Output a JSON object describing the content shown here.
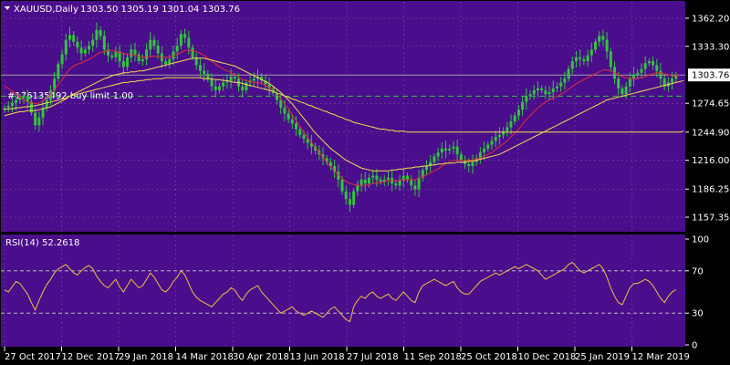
{
  "header": {
    "symbol": "XAUUSD,Daily",
    "ohlc": "1303.50 1305.19 1301.04 1303.76"
  },
  "colors": {
    "background": "#4a0d8c",
    "frame": "#000000",
    "candle": "#2fc73a",
    "ma_fast": "#e03030",
    "ma_slow": "#f4e04a",
    "rsi_line": "#f0c040",
    "grid": "#9ea0a6",
    "price_tag_bg": "#ffffff",
    "text": "#ffffff"
  },
  "order_label": "#176135492 buy limit 1.00",
  "rsi_label": "RSI(14) 52.2618",
  "chart_data": [
    {
      "type": "candlestick",
      "title": "XAUUSD,Daily",
      "x": [
        "27 Oct 2017",
        "12 Dec 2017",
        "29 Jan 2018",
        "14 Mar 2018",
        "30 Apr 2018",
        "13 Jun 2018",
        "27 Jul 2018",
        "11 Sep 2018",
        "25 Oct 2018",
        "10 Dec 2018",
        "25 Jan 2019",
        "12 Mar 2019"
      ],
      "price_axis_ticks": [
        "1362.20",
        "1333.30",
        "1303.76",
        "1274.65",
        "1244.90",
        "1216.00",
        "1186.25",
        "1157.35"
      ],
      "ylim": [
        1157.35,
        1362.2
      ],
      "current_price": 1303.76,
      "order_level": 1282,
      "close_series": [
        1270,
        1272,
        1275,
        1278,
        1280,
        1282,
        1276,
        1265,
        1252,
        1260,
        1270,
        1278,
        1288,
        1300,
        1315,
        1325,
        1340,
        1345,
        1338,
        1332,
        1326,
        1330,
        1334,
        1340,
        1350,
        1344,
        1330,
        1324,
        1322,
        1328,
        1318,
        1312,
        1322,
        1330,
        1325,
        1318,
        1320,
        1330,
        1340,
        1334,
        1326,
        1318,
        1315,
        1320,
        1328,
        1334,
        1346,
        1342,
        1332,
        1322,
        1314,
        1308,
        1305,
        1300,
        1292,
        1288,
        1292,
        1296,
        1298,
        1302,
        1300,
        1292,
        1288,
        1296,
        1298,
        1300,
        1302,
        1298,
        1294,
        1290,
        1285,
        1278,
        1270,
        1264,
        1258,
        1254,
        1248,
        1242,
        1238,
        1234,
        1230,
        1226,
        1222,
        1218,
        1214,
        1210,
        1204,
        1196,
        1184,
        1176,
        1170,
        1184,
        1190,
        1196,
        1192,
        1198,
        1200,
        1196,
        1194,
        1196,
        1198,
        1192,
        1190,
        1195,
        1200,
        1196,
        1190,
        1186,
        1198,
        1206,
        1210,
        1214,
        1220,
        1224,
        1228,
        1226,
        1228,
        1230,
        1222,
        1216,
        1212,
        1210,
        1214,
        1218,
        1224,
        1228,
        1232,
        1236,
        1240,
        1242,
        1246,
        1250,
        1256,
        1262,
        1268,
        1276,
        1282,
        1284,
        1288,
        1290,
        1288,
        1284,
        1286,
        1290,
        1292,
        1296,
        1300,
        1310,
        1318,
        1322,
        1320,
        1318,
        1324,
        1330,
        1338,
        1344,
        1340,
        1328,
        1312,
        1300,
        1290,
        1284,
        1292,
        1300,
        1304,
        1306,
        1310,
        1316,
        1318,
        1314,
        1308,
        1300,
        1292,
        1296,
        1300,
        1303.76
      ],
      "series": [
        {
          "name": "MA (red)",
          "values": [
            1292,
            1290,
            1287,
            1284,
            1281,
            1278,
            1276,
            1275,
            1274,
            1275,
            1277,
            1280,
            1284,
            1289,
            1294,
            1299,
            1305,
            1310,
            1313,
            1315,
            1316,
            1318,
            1320,
            1322,
            1325,
            1327,
            1328,
            1329,
            1329,
            1328,
            1327,
            1326,
            1325,
            1325,
            1324,
            1323,
            1322,
            1322,
            1323,
            1323,
            1323,
            1322,
            1322,
            1322,
            1323,
            1325,
            1327,
            1329,
            1329,
            1329,
            1328,
            1326,
            1324,
            1321,
            1318,
            1315,
            1312,
            1310,
            1308,
            1306,
            1304,
            1302,
            1299,
            1298,
            1297,
            1296,
            1296,
            1295,
            1293,
            1291,
            1288,
            1284,
            1279,
            1274,
            1269,
            1263,
            1257,
            1251,
            1245,
            1239,
            1234,
            1229,
            1224,
            1219,
            1214,
            1209,
            1205,
            1201,
            1197,
            1194,
            1192,
            1191,
            1190,
            1190,
            1190,
            1191,
            1192,
            1193,
            1193,
            1194,
            1195,
            1195,
            1195,
            1195,
            1196,
            1196,
            1196,
            1196,
            1197,
            1199,
            1201,
            1203,
            1205,
            1207,
            1210,
            1212,
            1214,
            1216,
            1216,
            1216,
            1216,
            1216,
            1216,
            1217,
            1218,
            1220,
            1222,
            1224,
            1227,
            1230,
            1233,
            1236,
            1240,
            1244,
            1248,
            1253,
            1258,
            1262,
            1266,
            1270,
            1273,
            1276,
            1278,
            1280,
            1282,
            1284,
            1286,
            1289,
            1292,
            1295,
            1297,
            1299,
            1301,
            1303,
            1305,
            1307,
            1309,
            1309,
            1308,
            1306,
            1304,
            1302,
            1301,
            1300,
            1300,
            1300,
            1301,
            1302,
            1304,
            1305,
            1306,
            1306,
            1305,
            1304,
            1303,
            1303,
            1303.5
          ]
        },
        {
          "name": "MA (yellow, medium)",
          "values": [
            1262,
            1263,
            1264,
            1265,
            1266,
            1266,
            1267,
            1267,
            1267,
            1268,
            1269,
            1270,
            1271,
            1273,
            1275,
            1277,
            1279,
            1282,
            1284,
            1286,
            1288,
            1290,
            1292,
            1294,
            1296,
            1298,
            1300,
            1301,
            1303,
            1304,
            1305,
            1306,
            1306,
            1307,
            1307,
            1308,
            1308,
            1309,
            1310,
            1311,
            1312,
            1313,
            1314,
            1315,
            1316,
            1317,
            1318,
            1319,
            1320,
            1321,
            1321,
            1321,
            1321,
            1320,
            1319,
            1318,
            1317,
            1316,
            1315,
            1314,
            1313,
            1311,
            1309,
            1307,
            1305,
            1303,
            1301,
            1299,
            1297,
            1295,
            1292,
            1289,
            1286,
            1282,
            1278,
            1274,
            1269,
            1264,
            1259,
            1254,
            1249,
            1244,
            1240,
            1236,
            1232,
            1228,
            1225,
            1222,
            1219,
            1216,
            1214,
            1212,
            1210,
            1208,
            1207,
            1206,
            1205,
            1205,
            1205,
            1205,
            1205,
            1206,
            1206,
            1207,
            1207,
            1208,
            1208,
            1209,
            1209,
            1210,
            1210,
            1211,
            1211,
            1212,
            1212,
            1213,
            1213,
            1213,
            1214,
            1214,
            1214,
            1215,
            1215,
            1216,
            1217,
            1218,
            1219,
            1220,
            1221,
            1222,
            1224,
            1226,
            1228,
            1230,
            1232,
            1234,
            1236,
            1238,
            1240,
            1242,
            1244,
            1246,
            1248,
            1250,
            1252,
            1254,
            1256,
            1258,
            1260,
            1262,
            1264,
            1266,
            1268,
            1270,
            1272,
            1274,
            1276,
            1278,
            1279,
            1280,
            1281,
            1282,
            1283,
            1284,
            1285,
            1286,
            1287,
            1288,
            1289,
            1290,
            1291,
            1292,
            1293,
            1294,
            1295,
            1296,
            1297,
            1298
          ]
        },
        {
          "name": "MA (yellow, slow)",
          "values": [
            1268,
            1269,
            1269,
            1270,
            1270,
            1271,
            1271,
            1272,
            1272,
            1273,
            1274,
            1275,
            1276,
            1277,
            1278,
            1279,
            1280,
            1282,
            1283,
            1284,
            1285,
            1286,
            1287,
            1288,
            1289,
            1290,
            1291,
            1292,
            1293,
            1294,
            1295,
            1296,
            1296,
            1297,
            1297,
            1298,
            1298,
            1299,
            1299,
            1300,
            1300,
            1300,
            1301,
            1301,
            1301,
            1301,
            1301,
            1301,
            1301,
            1301,
            1301,
            1301,
            1300,
            1300,
            1300,
            1299,
            1299,
            1298,
            1298,
            1297,
            1296,
            1296,
            1295,
            1294,
            1293,
            1292,
            1291,
            1290,
            1289,
            1288,
            1287,
            1285,
            1284,
            1282,
            1281,
            1279,
            1278,
            1276,
            1275,
            1273,
            1272,
            1270,
            1269,
            1267,
            1266,
            1264,
            1263,
            1261,
            1260,
            1258,
            1257,
            1255,
            1254,
            1253,
            1252,
            1251,
            1250,
            1249,
            1248,
            1248,
            1247,
            1247,
            1246,
            1246,
            1246,
            1245,
            1245,
            1245,
            1245,
            1245,
            1245,
            1245,
            1245,
            1245,
            1245,
            1245,
            1245,
            1245,
            1245,
            1245,
            1245,
            1245,
            1245,
            1245,
            1245,
            1245,
            1245,
            1245,
            1245,
            1245,
            1245,
            1245,
            1245,
            1245,
            1245,
            1245,
            1245,
            1245,
            1245,
            1245,
            1245,
            1245,
            1245,
            1245,
            1245,
            1245,
            1245,
            1245,
            1245,
            1245,
            1245,
            1245,
            1245,
            1245,
            1245,
            1245,
            1245,
            1245,
            1245,
            1245,
            1245,
            1245,
            1245,
            1245,
            1245,
            1245,
            1245,
            1245,
            1245,
            1245,
            1245,
            1245,
            1245,
            1245,
            1245,
            1245,
            1245,
            1246
          ]
        }
      ]
    },
    {
      "type": "line",
      "title": "RSI(14) 52.2618",
      "ylim": [
        0,
        100
      ],
      "y_ticks": [
        "100",
        "70",
        "30",
        "0"
      ],
      "levels": [
        70,
        30
      ],
      "series": [
        {
          "name": "RSI(14)",
          "values": [
            52,
            50,
            55,
            60,
            58,
            53,
            48,
            40,
            33,
            42,
            50,
            57,
            62,
            68,
            72,
            74,
            76,
            72,
            68,
            66,
            70,
            73,
            75,
            72,
            65,
            60,
            56,
            54,
            58,
            62,
            55,
            50,
            56,
            62,
            58,
            54,
            56,
            62,
            68,
            64,
            58,
            52,
            50,
            54,
            60,
            64,
            70,
            66,
            58,
            50,
            45,
            42,
            40,
            38,
            36,
            40,
            44,
            48,
            50,
            54,
            52,
            46,
            42,
            48,
            52,
            54,
            56,
            50,
            46,
            42,
            38,
            34,
            30,
            32,
            34,
            36,
            32,
            30,
            28,
            30,
            32,
            30,
            28,
            26,
            30,
            34,
            36,
            32,
            28,
            24,
            22,
            36,
            42,
            46,
            44,
            48,
            50,
            46,
            44,
            46,
            48,
            44,
            42,
            46,
            50,
            46,
            42,
            40,
            50,
            56,
            58,
            60,
            62,
            60,
            58,
            56,
            58,
            60,
            54,
            50,
            48,
            48,
            52,
            56,
            60,
            62,
            64,
            66,
            68,
            66,
            68,
            70,
            72,
            74,
            72,
            74,
            76,
            74,
            72,
            70,
            66,
            62,
            64,
            66,
            68,
            70,
            72,
            76,
            78,
            74,
            70,
            68,
            70,
            72,
            74,
            76,
            72,
            64,
            54,
            46,
            40,
            38,
            46,
            54,
            58,
            58,
            60,
            62,
            60,
            56,
            50,
            44,
            40,
            46,
            50,
            52.26
          ]
        }
      ]
    }
  ],
  "x_labels": [
    "27 Oct 2017",
    "12 Dec 2017",
    "29 Jan 2018",
    "14 Mar 2018",
    "30 Apr 2018",
    "13 Jun 2018",
    "27 Jul 2018",
    "11 Sep 2018",
    "25 Oct 2018",
    "10 Dec 2018",
    "25 Jan 2019",
    "12 Mar 2019"
  ]
}
